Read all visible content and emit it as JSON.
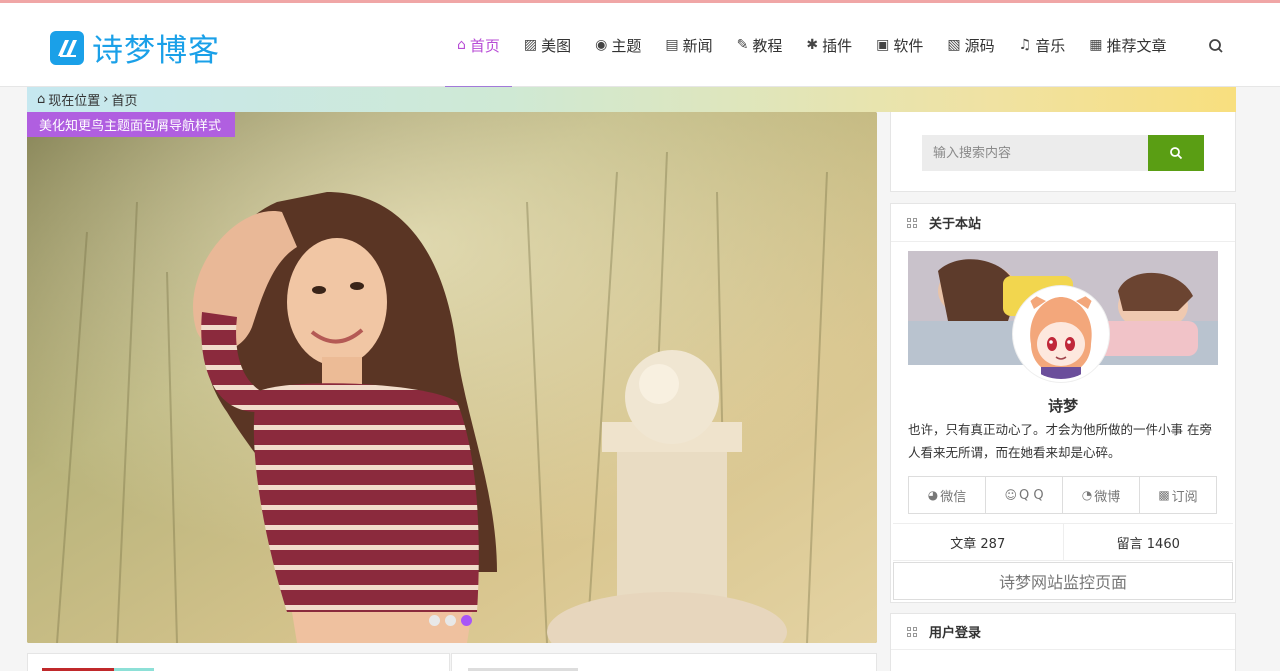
{
  "site": {
    "logo_text": "诗梦博客",
    "brand_color": "#1aa0e8",
    "accent_color": "#b84dd6"
  },
  "nav": {
    "items": [
      {
        "label": "首页",
        "icon": "home-icon",
        "active": true
      },
      {
        "label": "美图",
        "icon": "image-icon"
      },
      {
        "label": "主题",
        "icon": "palette-icon"
      },
      {
        "label": "新闻",
        "icon": "news-icon"
      },
      {
        "label": "教程",
        "icon": "edit-icon"
      },
      {
        "label": "插件",
        "icon": "puzzle-icon"
      },
      {
        "label": "软件",
        "icon": "app-icon"
      },
      {
        "label": "源码",
        "icon": "code-icon"
      },
      {
        "label": "音乐",
        "icon": "music-icon"
      },
      {
        "label": "推荐文章",
        "icon": "list-icon"
      }
    ],
    "search_icon": "search-icon"
  },
  "breadcrumb": {
    "prefix": "现在位置",
    "separator": "›",
    "current": "首页"
  },
  "slider": {
    "tag": "美化知更鸟主题面包屑导航样式",
    "dot_count": 3,
    "active_dot": 3
  },
  "sidebar": {
    "search": {
      "placeholder": "输入搜索内容"
    },
    "about": {
      "title": "关于本站",
      "name": "诗梦",
      "description": "也许，只有真正动心了。才会为他所做的一件小事 在旁人看来无所谓，而在她看来却是心碎。",
      "social": [
        {
          "label": "微信",
          "icon": "wechat-icon"
        },
        {
          "label": "Q Q",
          "icon": "qq-icon"
        },
        {
          "label": "微博",
          "icon": "weibo-icon"
        },
        {
          "label": "订阅",
          "icon": "rss-icon"
        }
      ],
      "stats": {
        "articles": "文章 287",
        "comments": "留言 1460"
      },
      "monitor_link": "诗梦网站监控页面"
    },
    "login": {
      "title": "用户登录"
    }
  }
}
